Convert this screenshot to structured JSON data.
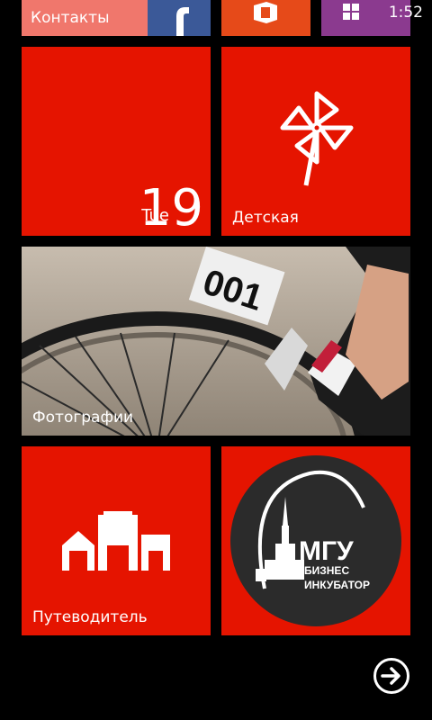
{
  "status": {
    "time": "1:52"
  },
  "tiles": {
    "contacts": {
      "label": "Контакты"
    },
    "calendar": {
      "day": "Tue",
      "date": "19"
    },
    "kids": {
      "label": "Детская"
    },
    "photos": {
      "label": "Фотографии",
      "race_number": "001"
    },
    "guide": {
      "label": "Путеводитель"
    },
    "msu": {
      "line1": "МГУ",
      "line2": "БИЗНЕС",
      "line3": "ИНКУБАТОР"
    }
  },
  "colors": {
    "accent": "#e51400",
    "contacts_bg": "#f0776c",
    "facebook_bg": "#3b5998",
    "office_bg": "#e64a19",
    "store_bg": "#8b3a8f",
    "background": "#000000"
  },
  "icons": {
    "next": "arrow-right-circle-icon",
    "kids": "pinwheel-icon",
    "guide": "buildings-icon",
    "facebook": "facebook-icon",
    "office": "office-icon",
    "store": "store-icon"
  }
}
